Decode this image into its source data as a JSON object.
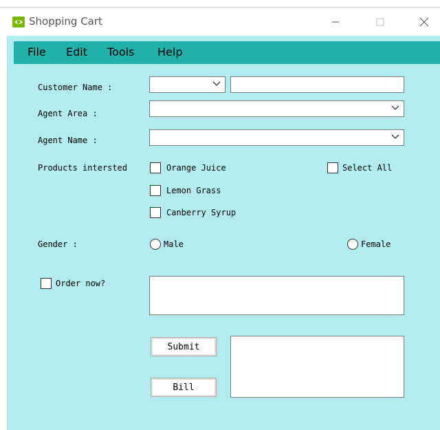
{
  "window": {
    "title": "Shopping Cart",
    "icon": "nvidia-logo-icon",
    "controls": [
      "minimize-icon",
      "maximize-icon",
      "close-icon"
    ]
  },
  "colors": {
    "menu_bar": "#20b2aa",
    "client_bg": "#b2ecee",
    "field_bg": "#ffffff"
  },
  "menu": {
    "file": "File",
    "edit": "Edit",
    "tools": "Tools",
    "help": "Help"
  },
  "form": {
    "customer_name_label": "Customer Name :",
    "customer_name_select_value": "",
    "customer_name_value": "",
    "agent_area_label": "Agent Area :",
    "agent_area_value": "",
    "agent_name_label": "Agent Name :",
    "agent_name_value": "",
    "products_label": "Products intersted",
    "products": [
      "Orange Juice",
      "Lemon Grass",
      "Canberry Syrup"
    ],
    "products_checked": [
      false,
      false,
      false
    ],
    "select_all_label": "Select All",
    "gender_label": "Gender :",
    "gender_options": [
      "Male",
      "Female"
    ],
    "order_now_label": "Order now?",
    "order_notes_value": "",
    "submit_label": "Submit",
    "bill_label": "Bill",
    "output_value": ""
  }
}
